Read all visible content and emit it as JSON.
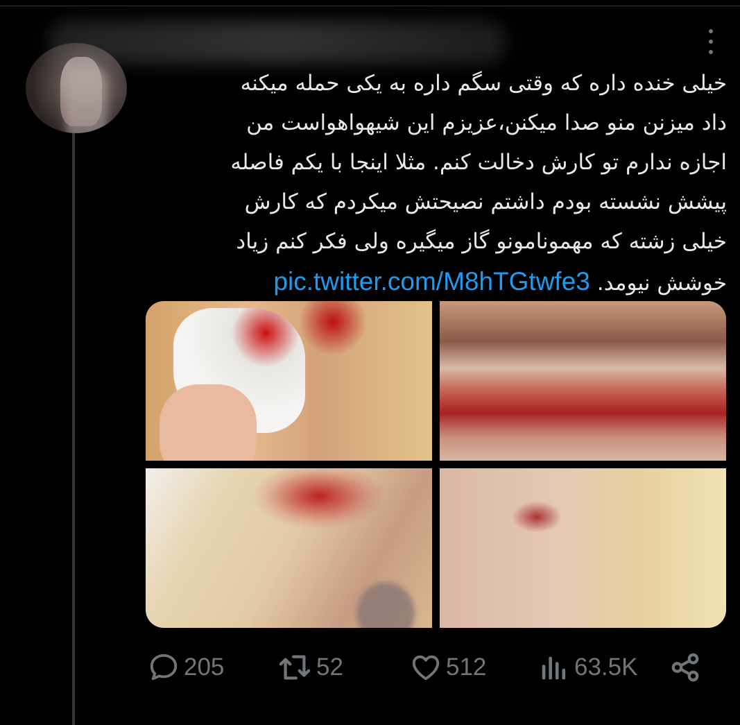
{
  "tweet": {
    "text_lines": [
      "خیلی خنده داره که وقتی سگم داره به یکی حمله میکنه",
      "داد میزنن منو صدا میکنن،عزیزم این شیهواهواست من",
      "اجازه ندارم تو کارش دخالت کنم. مثلا اینجا با یکم فاصله",
      "پیشش نشسته بودم داشتم نصیحتش میکردم که کارش",
      "خیلی زشته که مهمونامونو گاز میگیره ولی فکر کنم زیاد",
      "خوشش نیومد."
    ],
    "link": "pic.twitter.com/M8hTGtwfe3"
  },
  "actions": {
    "replies": "205",
    "retweets": "52",
    "likes": "512",
    "views": "63.5K"
  },
  "colors": {
    "background": "#000000",
    "text": "#e7e9ea",
    "muted": "#71767b",
    "link": "#1d9bf0"
  },
  "icons": [
    "more-icon",
    "reply-icon",
    "retweet-icon",
    "like-icon",
    "views-icon",
    "share-icon"
  ]
}
